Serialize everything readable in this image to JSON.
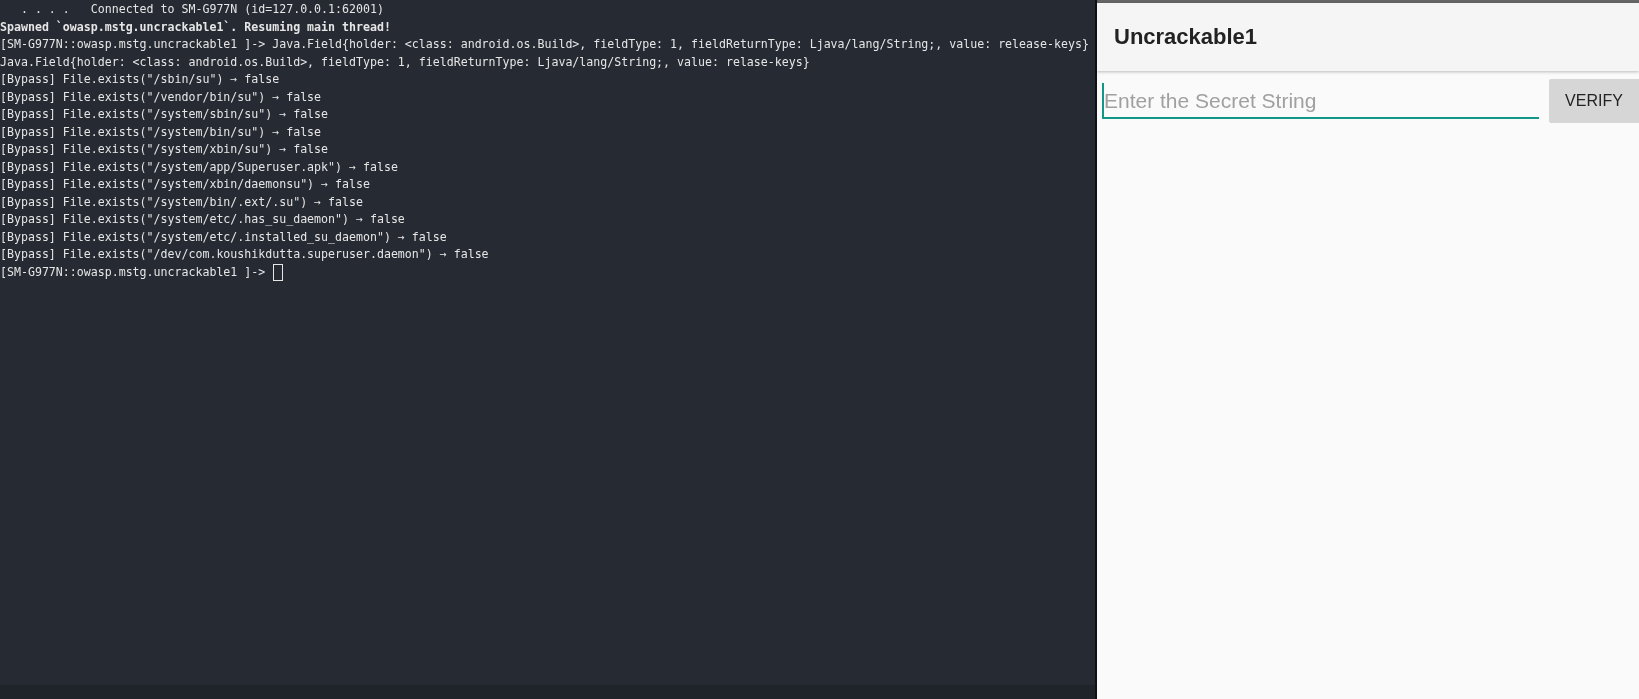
{
  "terminal": {
    "lines": [
      {
        "kind": "info",
        "text": "   . . . .   Connected to SM-G977N (id=127.0.0.1:62001)"
      },
      {
        "kind": "bold",
        "text": "Spawned `owasp.mstg.uncrackable1`. Resuming main thread!"
      },
      {
        "kind": "normal",
        "text": "[SM-G977N::owasp.mstg.uncrackable1 ]-> Java.Field{holder: <class: android.os.Build>, fieldType: 1, fieldReturnType: Ljava/lang/String;, value: release-keys}"
      },
      {
        "kind": "normal",
        "text": "Java.Field{holder: <class: android.os.Build>, fieldType: 1, fieldReturnType: Ljava/lang/String;, value: relase-keys}"
      },
      {
        "kind": "normal",
        "text": "[Bypass] File.exists(\"/sbin/su\") → false"
      },
      {
        "kind": "normal",
        "text": "[Bypass] File.exists(\"/vendor/bin/su\") → false"
      },
      {
        "kind": "normal",
        "text": "[Bypass] File.exists(\"/system/sbin/su\") → false"
      },
      {
        "kind": "normal",
        "text": "[Bypass] File.exists(\"/system/bin/su\") → false"
      },
      {
        "kind": "normal",
        "text": "[Bypass] File.exists(\"/system/xbin/su\") → false"
      },
      {
        "kind": "normal",
        "text": "[Bypass] File.exists(\"/system/app/Superuser.apk\") → false"
      },
      {
        "kind": "normal",
        "text": "[Bypass] File.exists(\"/system/xbin/daemonsu\") → false"
      },
      {
        "kind": "normal",
        "text": "[Bypass] File.exists(\"/system/bin/.ext/.su\") → false"
      },
      {
        "kind": "normal",
        "text": "[Bypass] File.exists(\"/system/etc/.has_su_daemon\") → false"
      },
      {
        "kind": "normal",
        "text": "[Bypass] File.exists(\"/system/etc/.installed_su_daemon\") → false"
      },
      {
        "kind": "normal",
        "text": "[Bypass] File.exists(\"/dev/com.koushikdutta.superuser.daemon\") → false"
      }
    ],
    "prompt": "[SM-G977N::owasp.mstg.uncrackable1 ]->"
  },
  "app": {
    "title": "Uncrackable1",
    "input": {
      "placeholder": "Enter the Secret String"
    },
    "button": "VERIFY"
  }
}
